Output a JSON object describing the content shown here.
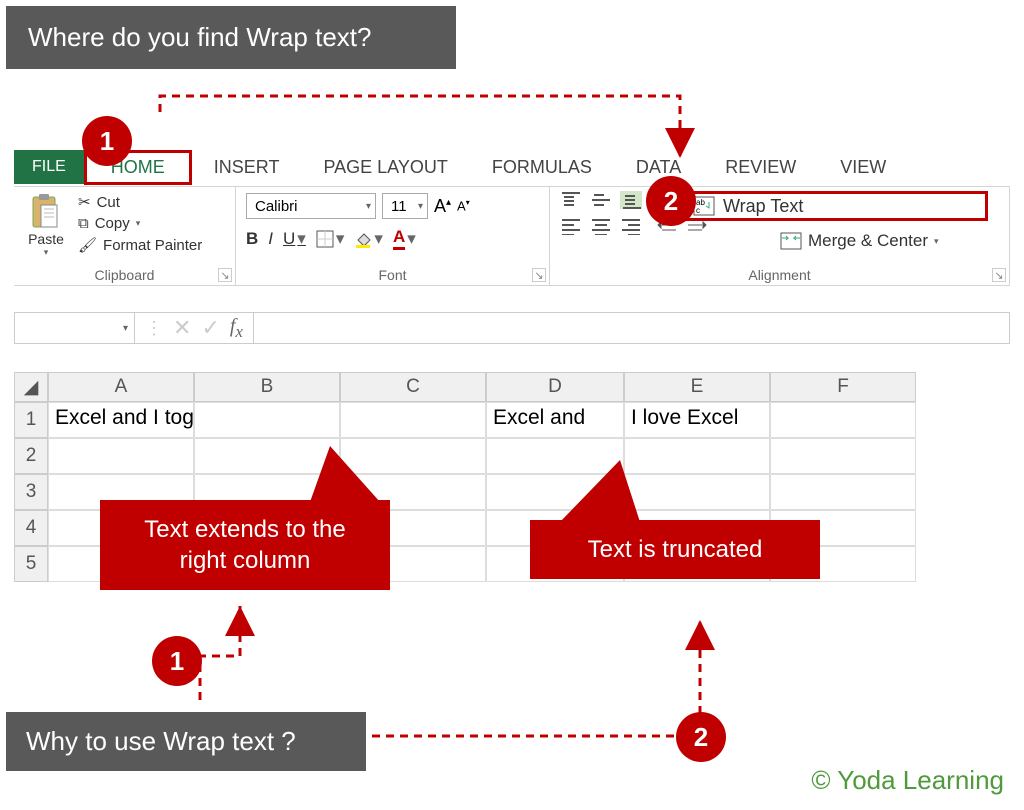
{
  "annotations": {
    "question_top": "Where do you find Wrap text?",
    "question_bottom": "Why to use Wrap text ?",
    "step1": "1",
    "step2": "2"
  },
  "callouts": {
    "extends": "Text extends to the right column",
    "truncated": "Text is truncated"
  },
  "tabs": {
    "file": "FILE",
    "home": "HOME",
    "insert": "INSERT",
    "page_layout": "PAGE LAYOUT",
    "formulas": "FORMULAS",
    "data": "DATA",
    "review": "REVIEW",
    "view": "VIEW"
  },
  "ribbon": {
    "clipboard": {
      "paste": "Paste",
      "cut": "Cut",
      "copy": "Copy",
      "format_painter": "Format Painter",
      "label": "Clipboard"
    },
    "font": {
      "name": "Calibri",
      "size": "11",
      "bold": "B",
      "italic": "I",
      "underline": "U",
      "label": "Font"
    },
    "alignment": {
      "wrap_text": "Wrap Text",
      "merge": "Merge & Center",
      "label": "Alignment"
    }
  },
  "grid": {
    "columns": [
      "A",
      "B",
      "C",
      "D",
      "E",
      "F"
    ],
    "rows": [
      "1",
      "2",
      "3",
      "4",
      "5"
    ],
    "cells": {
      "A1": "Excel and I together forever.",
      "D1": "Excel and I together forever.",
      "D1_display": "Excel and",
      "E1": "I love Excel"
    }
  },
  "copyright": "© Yoda Learning"
}
